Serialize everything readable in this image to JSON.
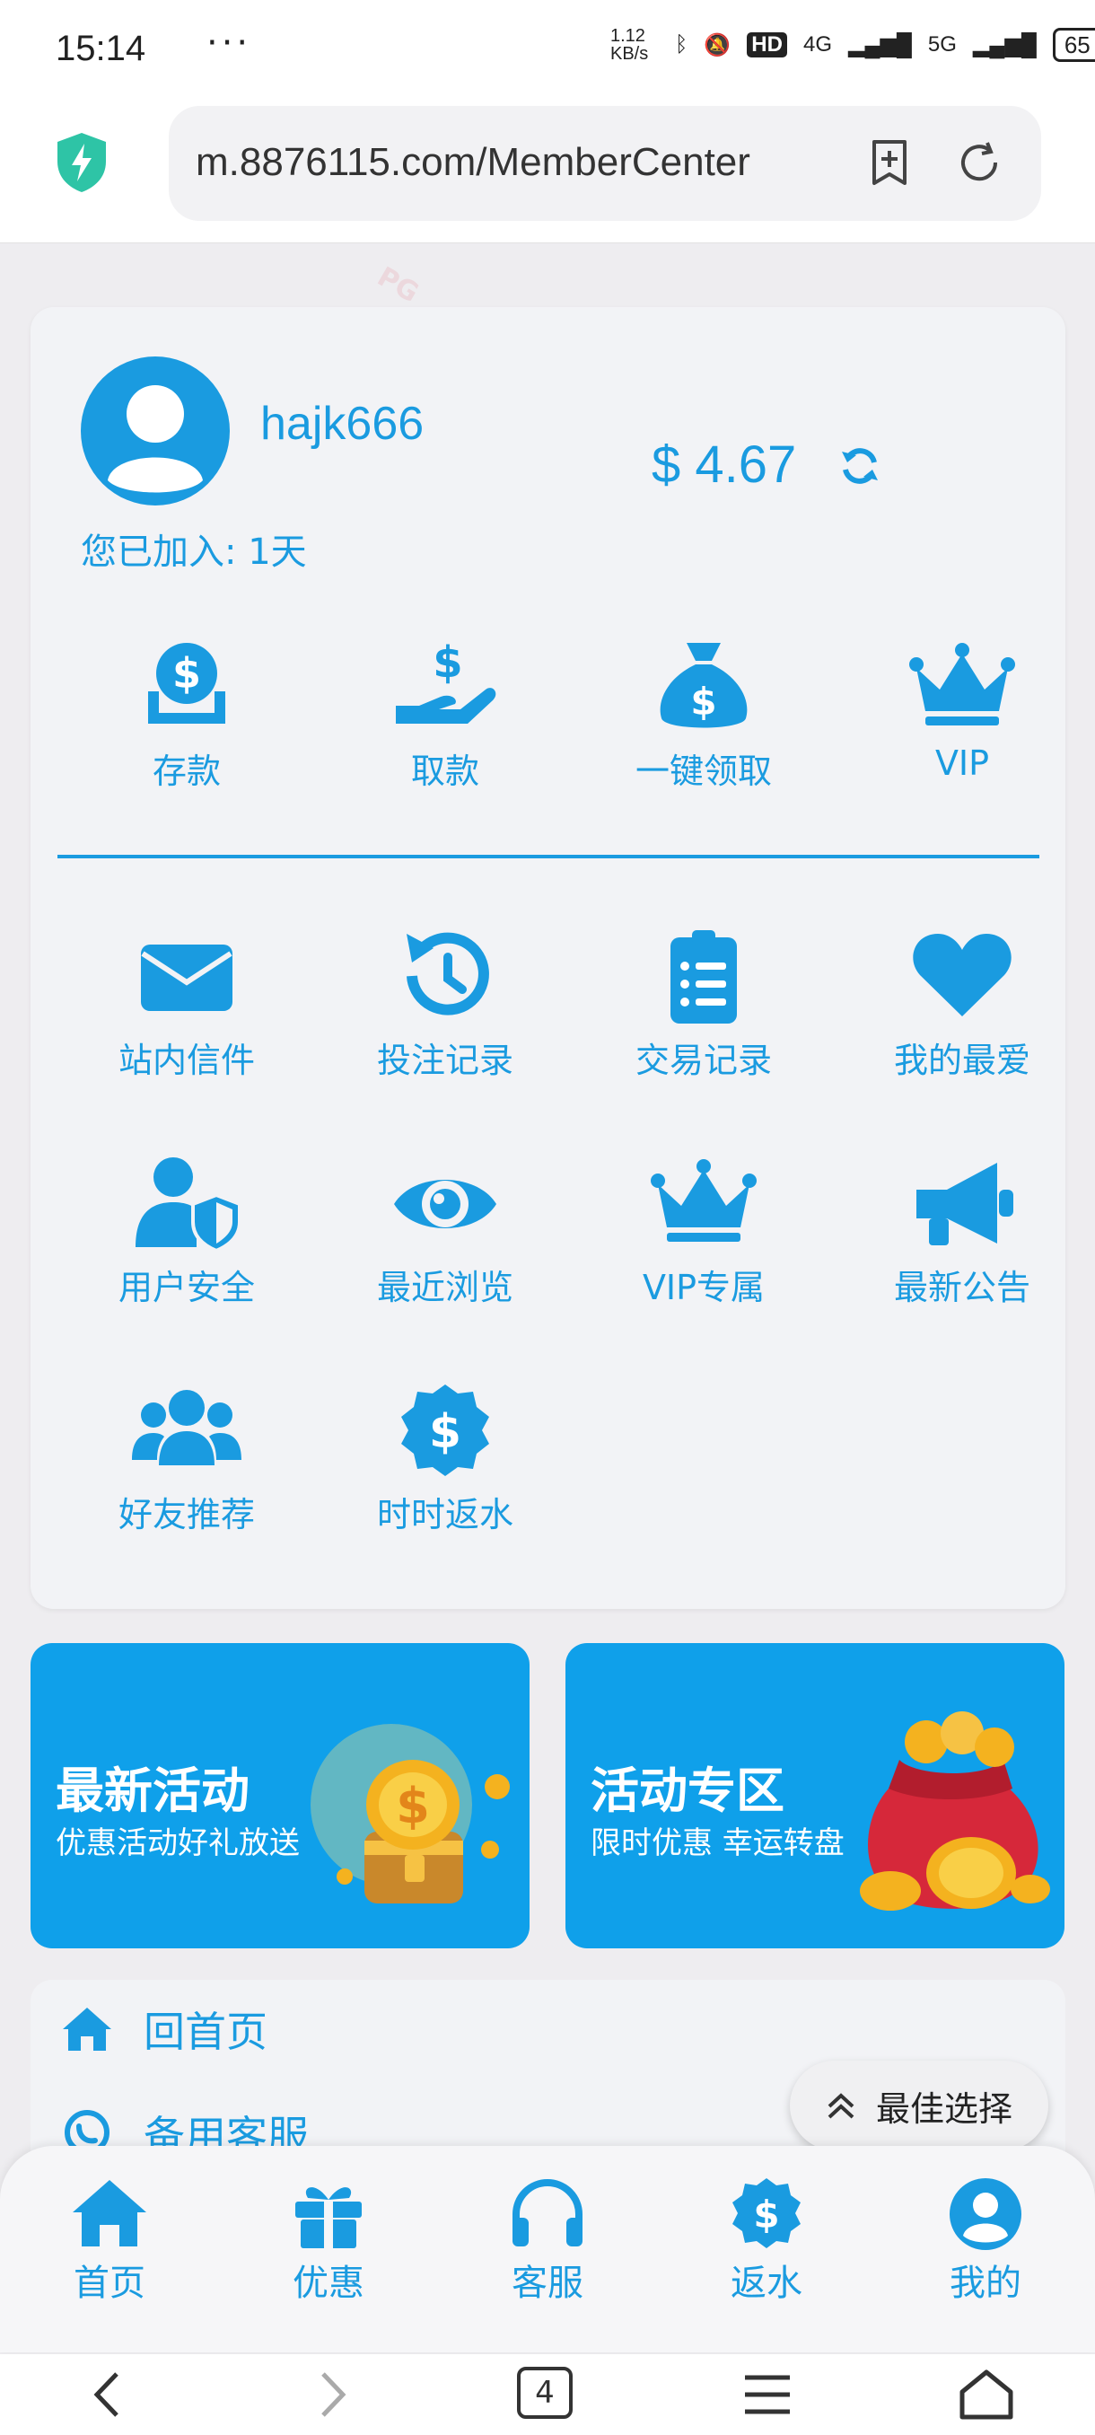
{
  "status_bar": {
    "time": "15:14",
    "more": "···",
    "net_speed": "1.12 KB/s",
    "hd": "HD",
    "net1": "4G",
    "net2": "5G",
    "battery": "65"
  },
  "browser": {
    "url": "m.8876115.com/MemberCenter"
  },
  "member": {
    "username": "hajk666",
    "balance": "$ 4.67",
    "joined": "您已加入: 1天"
  },
  "quick_actions": [
    {
      "label": "存款",
      "icon": "deposit-coin-icon"
    },
    {
      "label": "取款",
      "icon": "withdraw-hand-icon"
    },
    {
      "label": "一键领取",
      "icon": "money-bag-icon"
    },
    {
      "label": "VIP",
      "icon": "crown-icon"
    }
  ],
  "menu": [
    {
      "label": "站内信件",
      "icon": "envelope-icon"
    },
    {
      "label": "投注记录",
      "icon": "history-icon"
    },
    {
      "label": "交易记录",
      "icon": "clipboard-list-icon"
    },
    {
      "label": "我的最爱",
      "icon": "heart-icon"
    },
    {
      "label": "用户安全",
      "icon": "user-shield-icon"
    },
    {
      "label": "最近浏览",
      "icon": "eye-icon"
    },
    {
      "label": "VIP专属",
      "icon": "crown-icon"
    },
    {
      "label": "最新公告",
      "icon": "megaphone-icon"
    },
    {
      "label": "好友推荐",
      "icon": "users-icon"
    },
    {
      "label": "时时返水",
      "icon": "dollar-badge-icon"
    }
  ],
  "banners": [
    {
      "title": "最新活动",
      "subtitle": "优惠活动好礼放送"
    },
    {
      "title": "活动专区",
      "subtitle": "限时优惠 幸运转盘"
    }
  ],
  "links": [
    {
      "label": "回首页",
      "icon": "home-icon"
    },
    {
      "label": "备用客服",
      "icon": "whatsapp-icon"
    }
  ],
  "floating": {
    "label": "最佳选择"
  },
  "bottom_nav": [
    {
      "label": "首页",
      "icon": "home-icon"
    },
    {
      "label": "优惠",
      "icon": "gift-icon"
    },
    {
      "label": "客服",
      "icon": "headset-icon"
    },
    {
      "label": "返水",
      "icon": "dollar-badge-icon"
    },
    {
      "label": "我的",
      "icon": "user-circle-icon"
    }
  ],
  "system_nav": {
    "tabs_count": "4"
  },
  "colors": {
    "accent": "#1a9be0",
    "banner_bg": "#0fa0ea",
    "page_bg": "#eeedf0"
  }
}
